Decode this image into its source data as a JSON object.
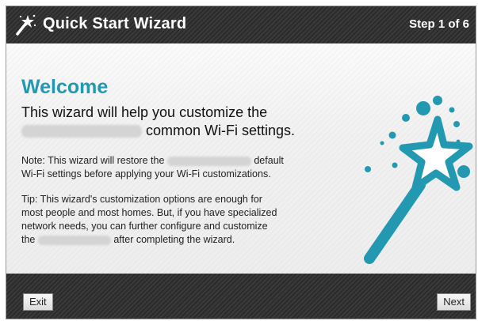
{
  "header": {
    "title": "Quick Start Wizard",
    "step": "Step 1 of 6"
  },
  "content": {
    "heading": "Welcome",
    "intro_line1": "This wizard will help you customize the",
    "intro_line2_suffix": "common Wi-Fi settings.",
    "note_prefix": "Note: This wizard will restore the",
    "note_suffix": "default",
    "note_line2": "Wi-Fi settings before applying your Wi-Fi customizations.",
    "tip_line1": "Tip: This wizard's customization options are enough for",
    "tip_line2": "most people and most homes. But, if you have specialized",
    "tip_line3": "network needs, you can further configure and customize",
    "tip_prefix4": "the",
    "tip_suffix4": "after completing the wizard."
  },
  "footer": {
    "exit_label": "Exit",
    "next_label": "Next"
  },
  "colors": {
    "accent": "#2399b1",
    "bar": "#2f2f2f"
  },
  "icons": {
    "title_icon": "magic-wand-icon",
    "illustration": "magic-wand-illustration"
  }
}
